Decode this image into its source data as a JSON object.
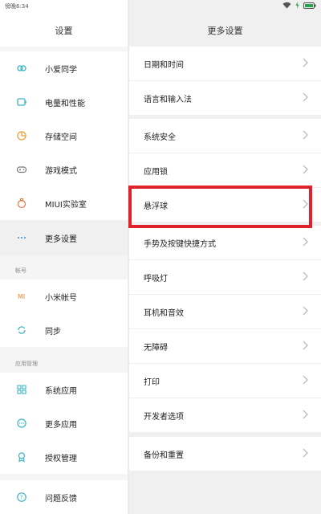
{
  "status": {
    "time": "傍晚6:34"
  },
  "left": {
    "title": "设置",
    "items": [
      {
        "label": "小爱同学",
        "icon": "xiaoai-icon"
      },
      {
        "label": "电量和性能",
        "icon": "battery-icon"
      },
      {
        "label": "存储空间",
        "icon": "storage-icon"
      },
      {
        "label": "游戏模式",
        "icon": "gamepad-icon"
      },
      {
        "label": "MIUI实验室",
        "icon": "flask-icon"
      },
      {
        "label": "更多设置",
        "icon": "more-dots-icon"
      }
    ],
    "account_section": "帐号",
    "account_items": [
      {
        "label": "小米帐号",
        "icon": "mi-icon"
      },
      {
        "label": "同步",
        "icon": "sync-icon"
      }
    ],
    "apps_section": "应用管理",
    "apps_items": [
      {
        "label": "系统应用",
        "icon": "grid-icon"
      },
      {
        "label": "更多应用",
        "icon": "more-apps-icon"
      },
      {
        "label": "授权管理",
        "icon": "badge-icon"
      },
      {
        "label": "问题反馈",
        "icon": "question-icon"
      }
    ]
  },
  "right": {
    "title": "更多设置",
    "groups": [
      [
        "日期和时间",
        "语言和输入法"
      ],
      [
        "系统安全",
        "应用锁",
        "悬浮球",
        "手势及按键快捷方式",
        "呼吸灯",
        "耳机和音效",
        "无障碍",
        "打印",
        "开发者选项"
      ],
      [
        "备份和重置"
      ]
    ]
  },
  "colors": {
    "highlight": "#e0222a",
    "accent": "#3bb4c1"
  }
}
